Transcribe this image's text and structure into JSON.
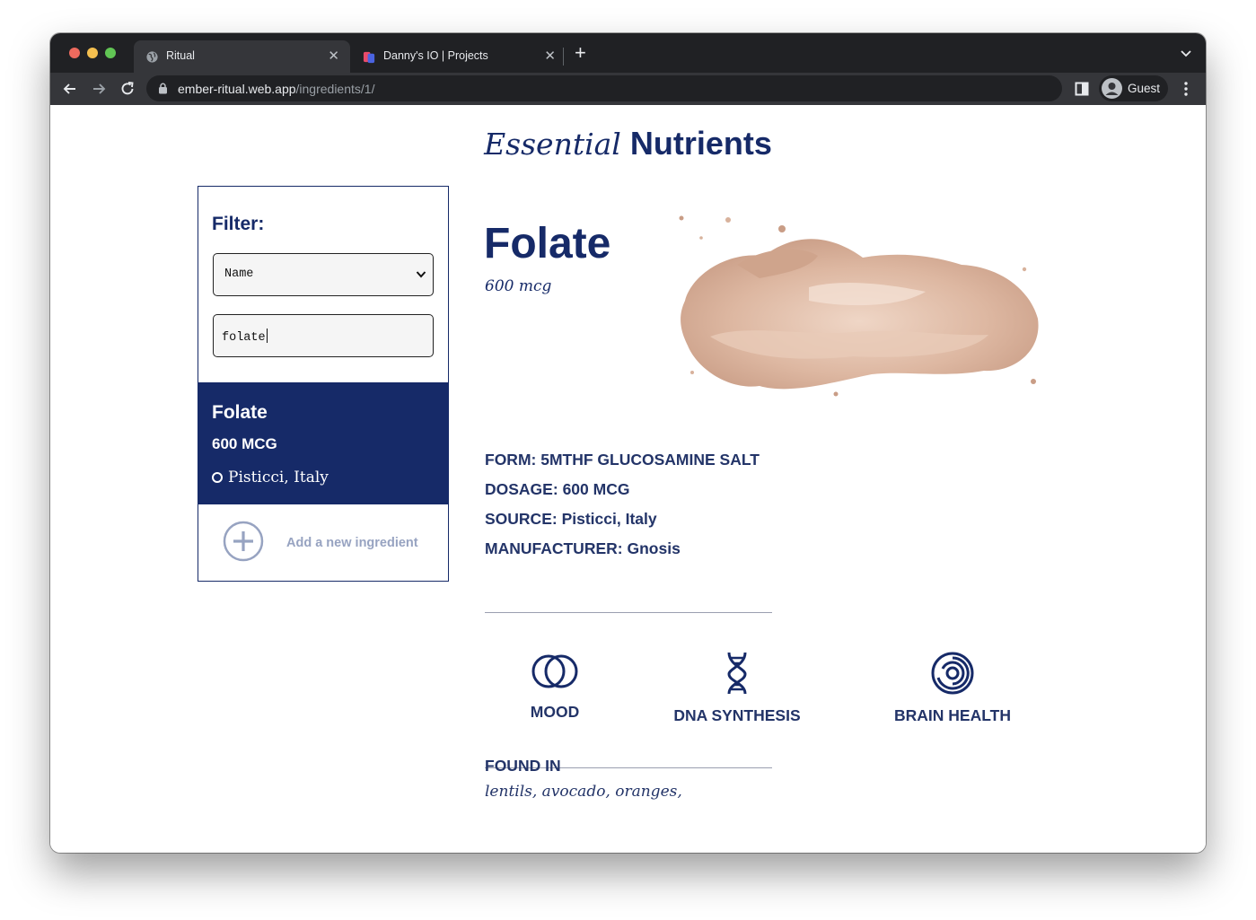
{
  "browser": {
    "tabs": [
      {
        "title": "Ritual",
        "active": true
      },
      {
        "title": "Danny's IO | Projects",
        "active": false
      }
    ],
    "url_host": "ember-ritual.web.app",
    "url_path": "/ingredients/1/",
    "profile_name": "Guest"
  },
  "page": {
    "brand_italic": "Essential",
    "brand_bold": "Nutrients"
  },
  "sidebar": {
    "filter_label": "Filter:",
    "filter_select_value": "Name",
    "search_value": "folate",
    "results": [
      {
        "name": "Folate",
        "dosage": "600 MCG",
        "source": "Pisticci, Italy"
      }
    ],
    "add_label": "Add a new ingredient"
  },
  "detail": {
    "name": "Folate",
    "dosage": "600 mcg",
    "facts": {
      "form_label": "FORM:",
      "form_value": "5MTHF GLUCOSAMINE SALT",
      "dosage_label": "DOSAGE:",
      "dosage_value": "600 MCG",
      "source_label": "SOURCE:",
      "source_value": "Pisticci, Italy",
      "manufacturer_label": "MANUFACTURER:",
      "manufacturer_value": "Gnosis"
    },
    "benefits": [
      {
        "label": "MOOD",
        "icon": "overlapping-circles-icon"
      },
      {
        "label": "DNA SYNTHESIS",
        "icon": "dna-icon"
      },
      {
        "label": "BRAIN HEALTH",
        "icon": "concentric-circles-icon"
      }
    ],
    "found_in_label": "FOUND IN",
    "found_in": "lentils, avocado, oranges,"
  },
  "colors": {
    "brand_navy": "#162a68",
    "muted_blue": "#97a3c1",
    "chrome_dark": "#202124",
    "chrome_toolbar": "#35363a"
  }
}
